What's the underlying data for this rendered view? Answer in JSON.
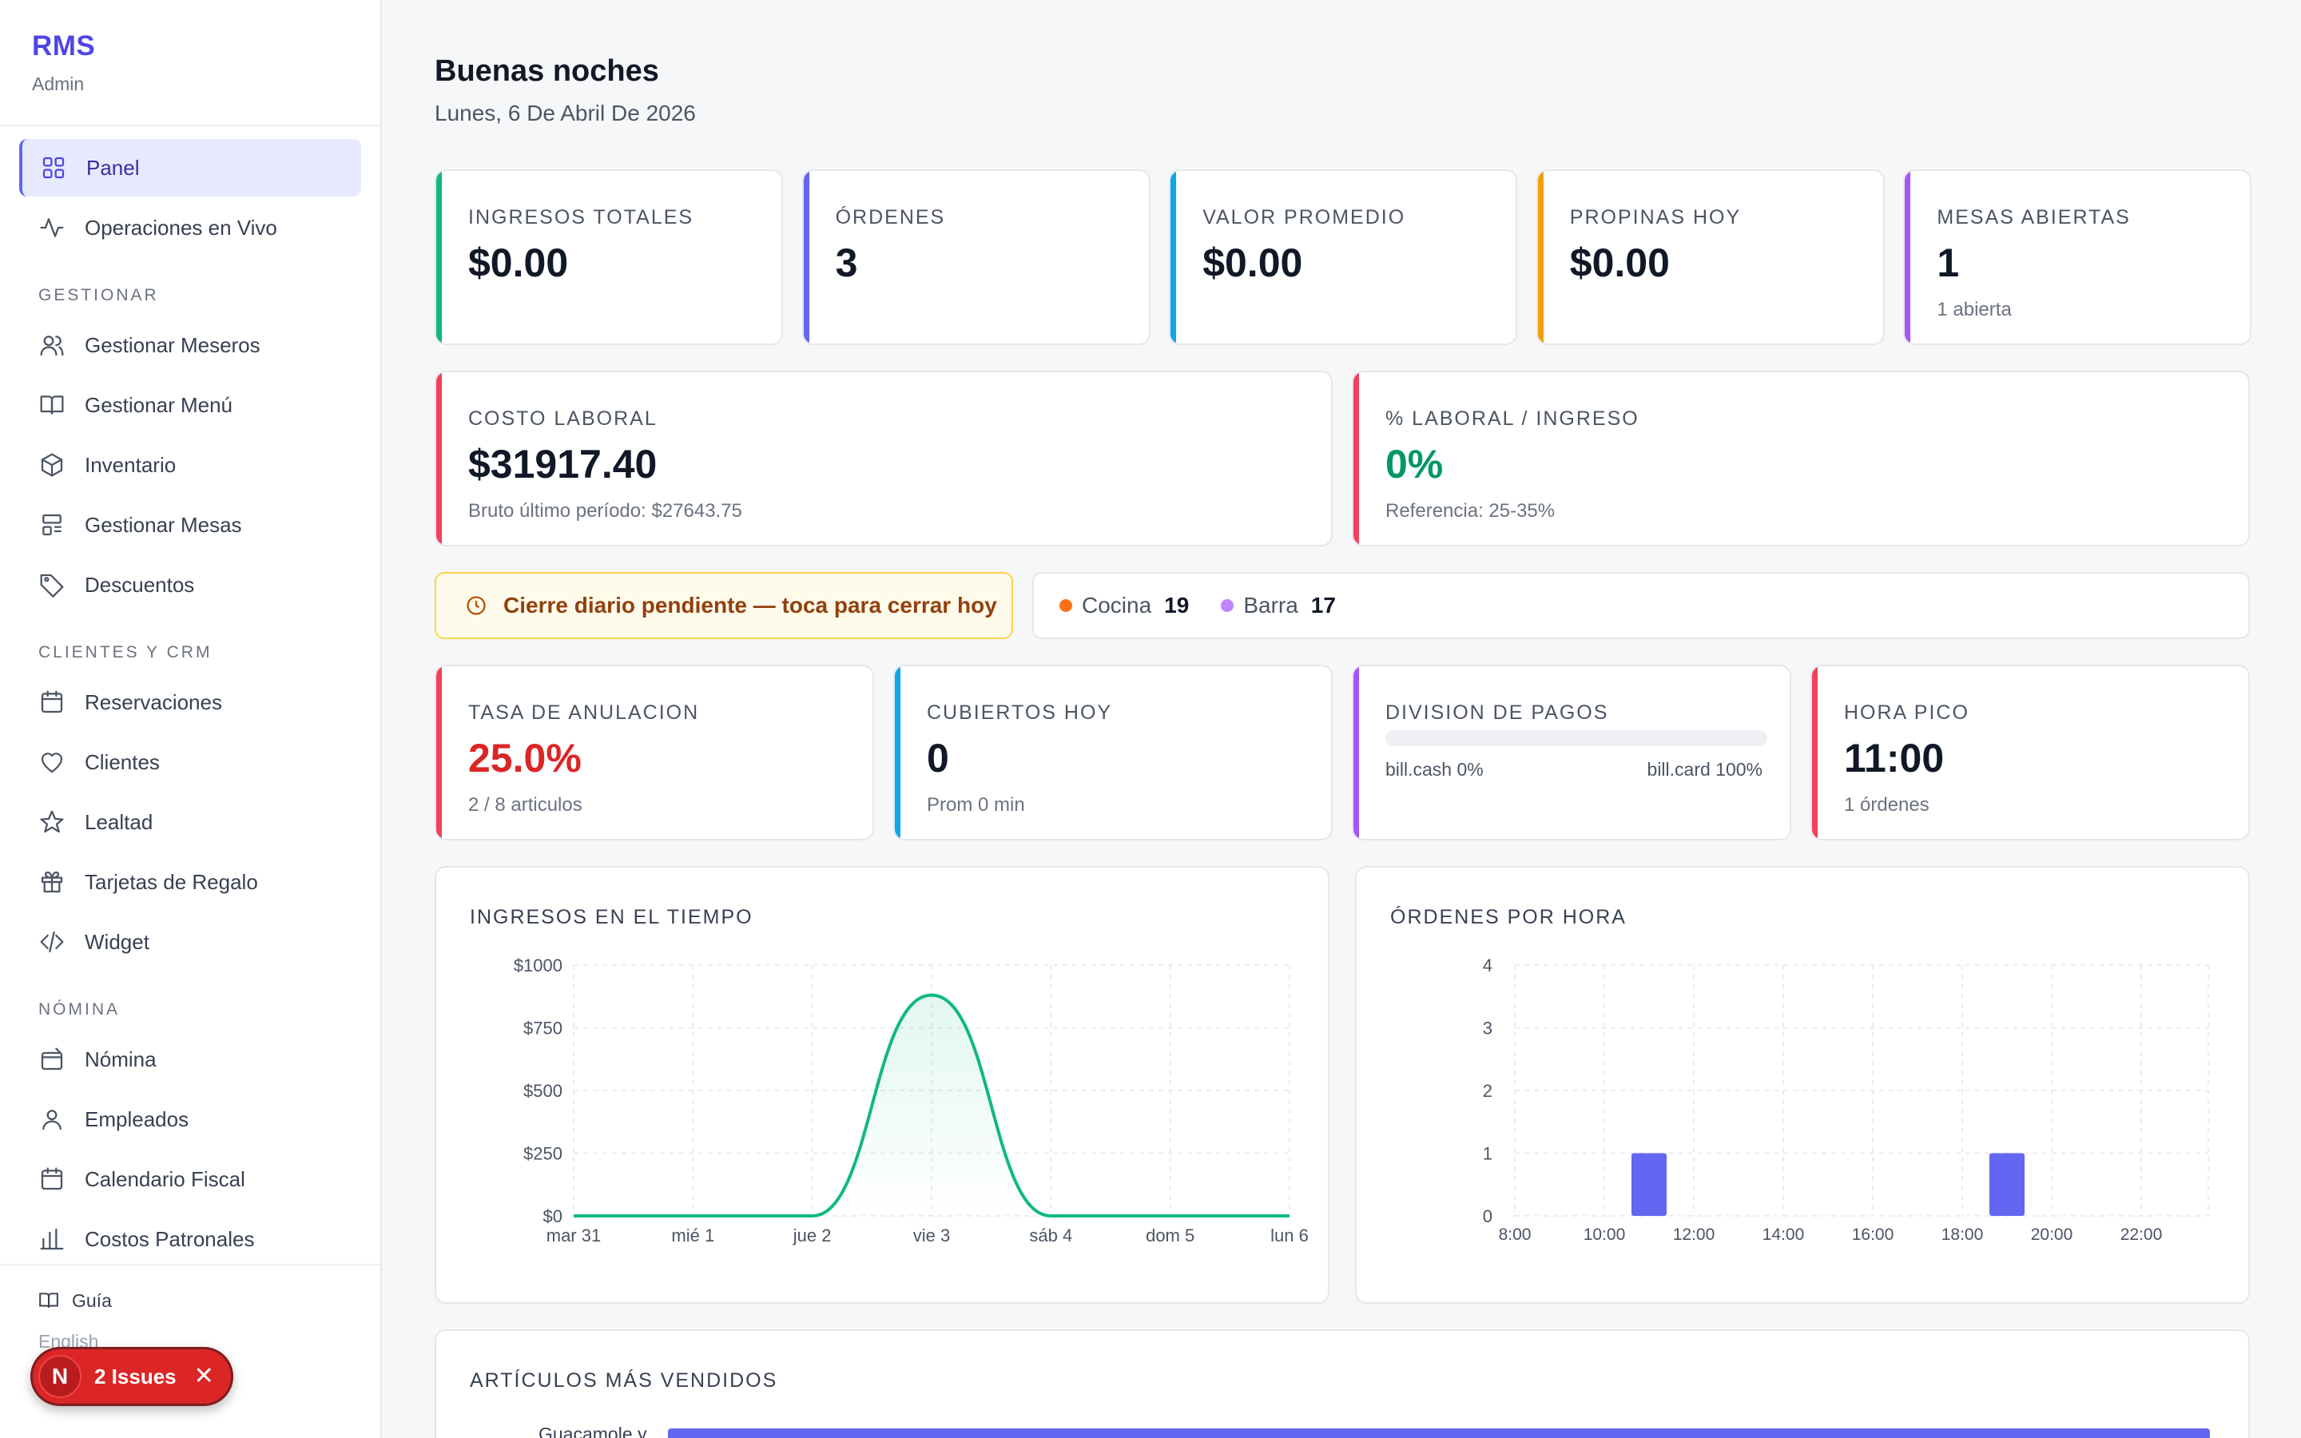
{
  "sidebar": {
    "brand": "RMS",
    "role": "Admin",
    "top_items": [
      {
        "label": "Panel",
        "icon": "grid-icon",
        "active": true
      },
      {
        "label": "Operaciones en Vivo",
        "icon": "activity-icon"
      }
    ],
    "sections": [
      {
        "title": "GESTIONAR",
        "items": [
          {
            "label": "Gestionar Meseros",
            "icon": "users-icon"
          },
          {
            "label": "Gestionar Menú",
            "icon": "book-open-icon"
          },
          {
            "label": "Inventario",
            "icon": "box-icon"
          },
          {
            "label": "Gestionar Mesas",
            "icon": "table-icon"
          },
          {
            "label": "Descuentos",
            "icon": "tag-icon"
          }
        ]
      },
      {
        "title": "CLIENTES Y CRM",
        "items": [
          {
            "label": "Reservaciones",
            "icon": "calendar-icon"
          },
          {
            "label": "Clientes",
            "icon": "heart-icon"
          },
          {
            "label": "Lealtad",
            "icon": "star-icon"
          },
          {
            "label": "Tarjetas de Regalo",
            "icon": "gift-icon"
          },
          {
            "label": "Widget",
            "icon": "code-icon"
          }
        ]
      },
      {
        "title": "NÓMINA",
        "items": [
          {
            "label": "Nómina",
            "icon": "wallet-icon"
          },
          {
            "label": "Empleados",
            "icon": "user-icon"
          },
          {
            "label": "Calendario Fiscal",
            "icon": "calendar-icon"
          },
          {
            "label": "Costos Patronales",
            "icon": "bar-chart-icon"
          }
        ]
      }
    ],
    "footer": {
      "guide": "Guía",
      "second": "English"
    }
  },
  "issues_badge": {
    "letter": "N",
    "label": "2 Issues",
    "close": "✕"
  },
  "header": {
    "greeting": "Buenas noches",
    "date": "Lunes, 6 De Abril De 2026"
  },
  "kpis_row1": [
    {
      "label": "INGRESOS TOTALES",
      "value": "$0.00",
      "sub": "",
      "color": "#10b981"
    },
    {
      "label": "ÓRDENES",
      "value": "3",
      "sub": "",
      "color": "#6366f1"
    },
    {
      "label": "VALOR PROMEDIO",
      "value": "$0.00",
      "sub": "",
      "color": "#0ea5e9"
    },
    {
      "label": "PROPINAS HOY",
      "value": "$0.00",
      "sub": "",
      "color": "#f59e0b"
    },
    {
      "label": "MESAS ABIERTAS",
      "value": "1",
      "sub": "1 abierta",
      "color": "#a855f7"
    }
  ],
  "kpis_row2": [
    {
      "label": "COSTO LABORAL",
      "value": "$31917.40",
      "sub": "Bruto último período: $27643.75",
      "color": "#f43f5e",
      "value_color": "#111827"
    },
    {
      "label": "% LABORAL / INGRESO",
      "value": "0%",
      "sub": "Referencia: 25-35%",
      "color": "#f43f5e",
      "value_color": "#059669"
    }
  ],
  "alert": {
    "text": "Cierre diario pendiente — toca para cerrar hoy"
  },
  "stations": [
    {
      "name": "Cocina",
      "count": "19",
      "color": "#f97316"
    },
    {
      "name": "Barra",
      "count": "17",
      "color": "#c084fc"
    }
  ],
  "kpis_row3": [
    {
      "label": "TASA DE ANULACION",
      "value": "25.0%",
      "sub": "2 / 8 articulos",
      "color": "#f43f5e",
      "value_color": "#dc2626"
    },
    {
      "label": "CUBIERTOS HOY",
      "value": "0",
      "sub": "Prom 0 min",
      "color": "#0ea5e9",
      "value_color": "#111827"
    },
    {
      "label": "DIVISION DE PAGOS",
      "split_left": "bill.cash 0%",
      "split_right": "bill.card 100%",
      "color": "#a855f7",
      "cash_fraction": 0
    },
    {
      "label": "HORA PICO",
      "value": "11:00",
      "sub": "1 órdenes",
      "color": "#f43f5e",
      "value_color": "#111827"
    }
  ],
  "charts_titles": {
    "revenue": "INGRESOS EN EL TIEMPO",
    "orders": "ÓRDENES POR HORA",
    "top_items": "ARTÍCULOS MÁS VENDIDOS"
  },
  "top_items_first_label": "Guacamole y",
  "chart_data": [
    {
      "type": "area",
      "title": "INGRESOS EN EL TIEMPO",
      "categories": [
        "mar 31",
        "mié 1",
        "jue 2",
        "vie 3",
        "sáb 4",
        "dom 5",
        "lun 6"
      ],
      "values": [
        0,
        0,
        0,
        880,
        0,
        0,
        0
      ],
      "y_ticks": [
        "$0",
        "$250",
        "$500",
        "$750",
        "$1000"
      ],
      "ylim": [
        0,
        1000
      ],
      "grid": true,
      "color": "#10b981"
    },
    {
      "type": "bar",
      "title": "ÓRDENES POR HORA",
      "x_ticks": [
        "8:00",
        "10:00",
        "12:00",
        "14:00",
        "16:00",
        "18:00",
        "20:00",
        "22:00"
      ],
      "bars": [
        {
          "hour": 11,
          "value": 1
        },
        {
          "hour": 19,
          "value": 1
        }
      ],
      "y_ticks": [
        "0",
        "1",
        "2",
        "3",
        "4"
      ],
      "ylim": [
        0,
        4
      ],
      "xlim": [
        8,
        23.5
      ],
      "grid": true,
      "color": "#6366f1"
    },
    {
      "type": "bar",
      "orientation": "horizontal",
      "title": "ARTÍCULOS MÁS VENDIDOS",
      "categories": [
        "Guacamole y"
      ],
      "color": "#6366f1"
    }
  ]
}
